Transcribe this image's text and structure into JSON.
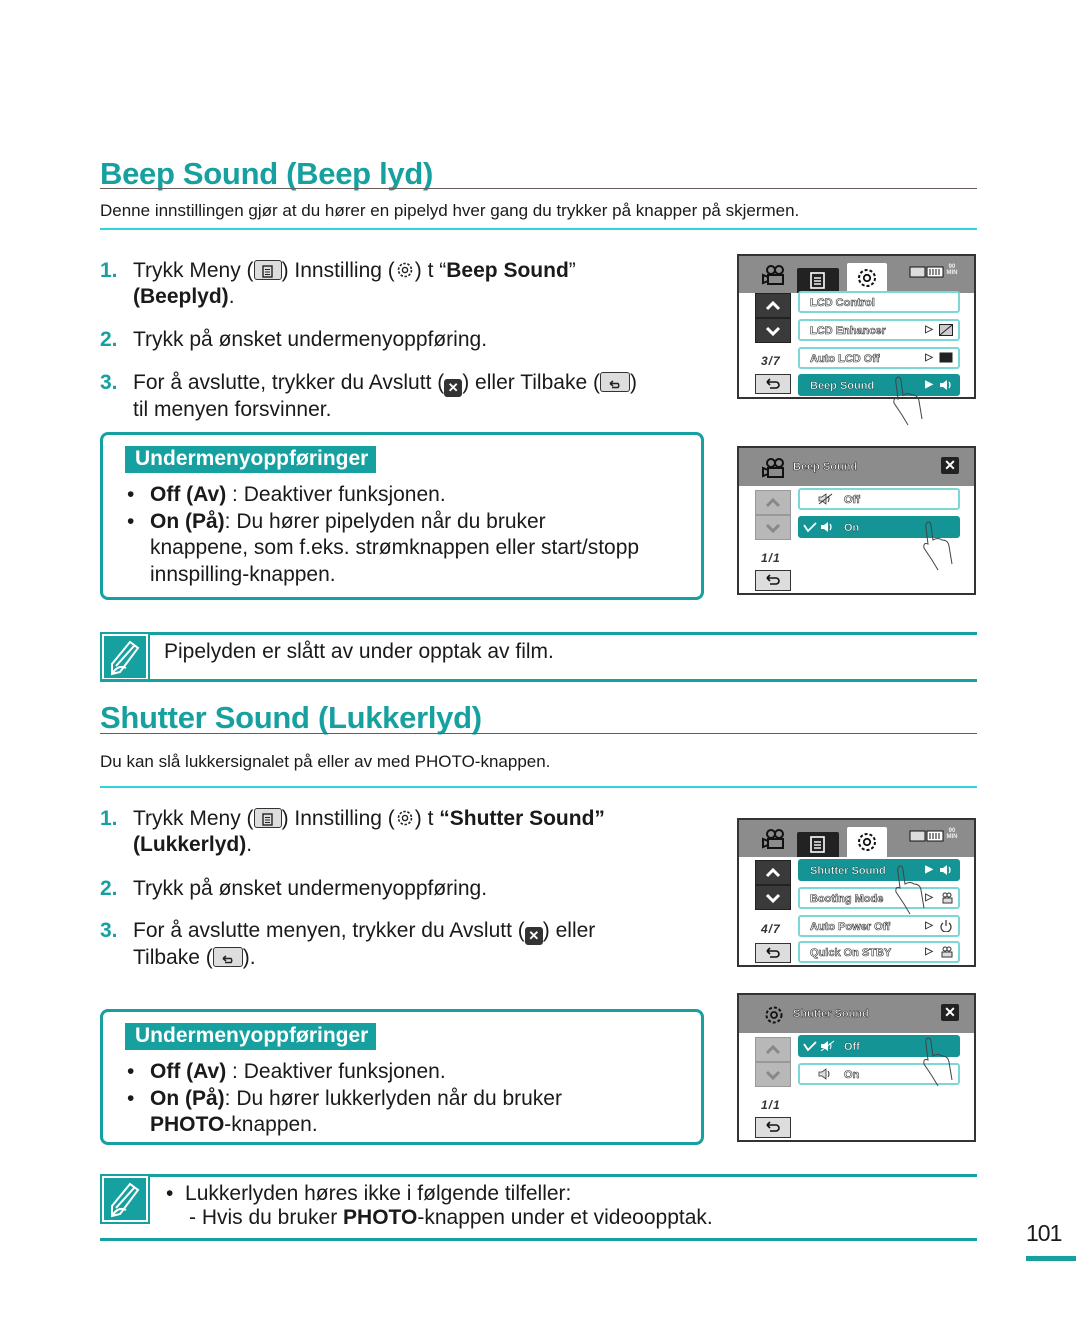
{
  "colors": {
    "accent": "#17a0a0",
    "rule_cyan": "#33d3dc",
    "selected_item": "#149494",
    "screen_header": "#8c8c8c"
  },
  "beep": {
    "title": "Beep Sound (Beep lyd)",
    "intro": "Denne innstillingen gjør at du hører en pipelyd hver gang du trykker på knapper på skjermen.",
    "steps": [
      {
        "num": "1.",
        "pre": "Trykk Meny (",
        "mid1": ") Innstilling (",
        "mid2": ")  t  “",
        "bold": "Beep Sound",
        "post": "”",
        "line2_bold": "(Beeplyd)",
        "line2_post": "."
      },
      {
        "num": "2.",
        "text": "Trykk på ønsket undermenyoppføring."
      },
      {
        "num": "3.",
        "pre": "For å avslutte, trykker du Avslutt (",
        "mid": ") eller Tilbake (",
        "post": ")",
        "line2": "til menyen forsvinner."
      }
    ],
    "submenu": {
      "title": "Undermenyoppføringer",
      "items": [
        {
          "bold": "Off (Av)",
          "text": " : Deaktiver funksjonen."
        },
        {
          "bold": "On (På)",
          "text": ": Du hører pipelyden når du bruker",
          "cont1": "knappene, som f.eks. strømknappen eller start/stopp",
          "cont2": "innspilling-knappen."
        }
      ]
    },
    "note": "Pipelyden er slått av under opptak av film.",
    "screen1": {
      "battery": "90 MIN",
      "page": "3/7",
      "items": [
        {
          "label": "LCD Control",
          "icon": "",
          "selected": false
        },
        {
          "label": "LCD Enhancer",
          "icon": "lcd-enhancer-icon",
          "selected": false
        },
        {
          "label": "Auto LCD Off",
          "icon": "lcd-off-icon",
          "selected": false
        },
        {
          "label": "Beep Sound",
          "icon": "speaker-icon",
          "selected": true
        }
      ]
    },
    "screen2": {
      "title": "Beep Sound",
      "page": "1/1",
      "options": [
        {
          "label": "Off",
          "checked": false,
          "selected": false
        },
        {
          "label": "On",
          "checked": true,
          "selected": true
        }
      ]
    }
  },
  "shutter": {
    "title": "Shutter Sound (Lukkerlyd)",
    "intro": "Du kan slå lukkersignalet på eller av med PHOTO-knappen.",
    "steps": [
      {
        "num": "1.",
        "pre": "Trykk Meny (",
        "mid1": ") Innstilling (",
        "mid2": ")  t  ",
        "bold": "“Shutter Sound”",
        "line2_bold": "(Lukkerlyd)",
        "line2_post": "."
      },
      {
        "num": "2.",
        "text": "Trykk på ønsket undermenyoppføring."
      },
      {
        "num": "3.",
        "pre": "For å avslutte menyen, trykker du Avslutt (",
        "post": ") eller",
        "line2_pre": "Tilbake (",
        "line2_post": ")."
      }
    ],
    "submenu": {
      "title": "Undermenyoppføringer",
      "items": [
        {
          "bold": "Off (Av)",
          "text": " : Deaktiver funksjonen."
        },
        {
          "bold": "On (På)",
          "text": ": Du hører lukkerlyden når du bruker",
          "cont_bold": "PHOTO",
          "cont": "-knappen."
        }
      ]
    },
    "note": {
      "bullet": "Lukkerlyden høres ikke i følgende tilfeller:",
      "sub_pre": "-  Hvis du bruker ",
      "sub_bold": "PHOTO",
      "sub_post": "-knappen under et videoopptak."
    },
    "screen1": {
      "battery": "90 MIN",
      "page": "4/7",
      "items": [
        {
          "label": "Shutter Sound",
          "icon": "speaker-icon",
          "selected": true
        },
        {
          "label": "Booting Mode",
          "icon": "camcorder-icon",
          "selected": false
        },
        {
          "label": "Auto Power Off",
          "icon": "power-timer-icon",
          "selected": false
        },
        {
          "label": "Quick On STBY",
          "icon": "quick-standby-icon",
          "selected": false
        }
      ]
    },
    "screen2": {
      "title": "Shutter Sound",
      "page": "1/1",
      "options": [
        {
          "label": "Off",
          "checked": true,
          "selected": true
        },
        {
          "label": "On",
          "checked": false,
          "selected": false
        }
      ]
    }
  },
  "page_number": "101"
}
